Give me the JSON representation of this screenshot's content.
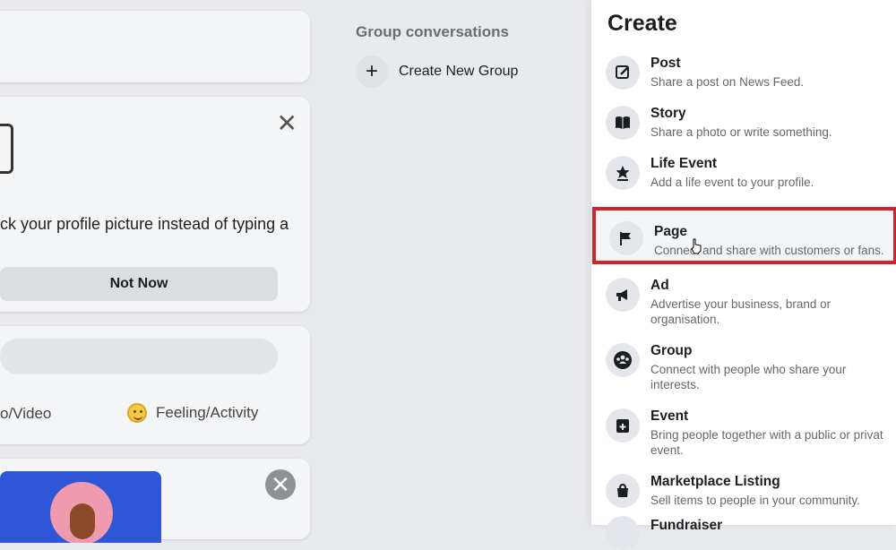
{
  "left": {
    "pic_card": {
      "close_glyph": "✕",
      "message": "ck your profile picture instead of typing a",
      "not_now": "Not Now"
    },
    "compose": {
      "photo_video": "o/Video",
      "feeling": "Feeling/Activity"
    },
    "bottom_close_glyph": "✕"
  },
  "middle": {
    "heading": "Group conversations",
    "create_group": "Create New Group",
    "plus_glyph": "+"
  },
  "panel": {
    "title": "Create",
    "items": [
      {
        "title": "Post",
        "desc": "Share a post on News Feed.",
        "icon": "edit-icon"
      },
      {
        "title": "Story",
        "desc": "Share a photo or write something.",
        "icon": "book-icon"
      },
      {
        "title": "Life Event",
        "desc": "Add a life event to your profile.",
        "icon": "star-icon"
      },
      {
        "title": "Page",
        "desc": "Connect and share with customers or fans.",
        "icon": "flag-icon"
      },
      {
        "title": "Ad",
        "desc": "Advertise your business, brand or",
        "desc2": "organisation.",
        "icon": "megaphone-icon"
      },
      {
        "title": "Group",
        "desc": "Connect with people who share your",
        "desc2": "interests.",
        "icon": "group-icon"
      },
      {
        "title": "Event",
        "desc": "Bring people together with a public or privat",
        "desc2": "event.",
        "icon": "calendar-icon"
      },
      {
        "title": "Marketplace Listing",
        "desc": "Sell items to people in your community.",
        "icon": "shopping-bag-icon"
      },
      {
        "title": "Fundraiser",
        "icon": "fundraiser-icon"
      }
    ]
  },
  "colors": {
    "highlight": "#d2232a",
    "accent_blue": "#2f56d6"
  }
}
